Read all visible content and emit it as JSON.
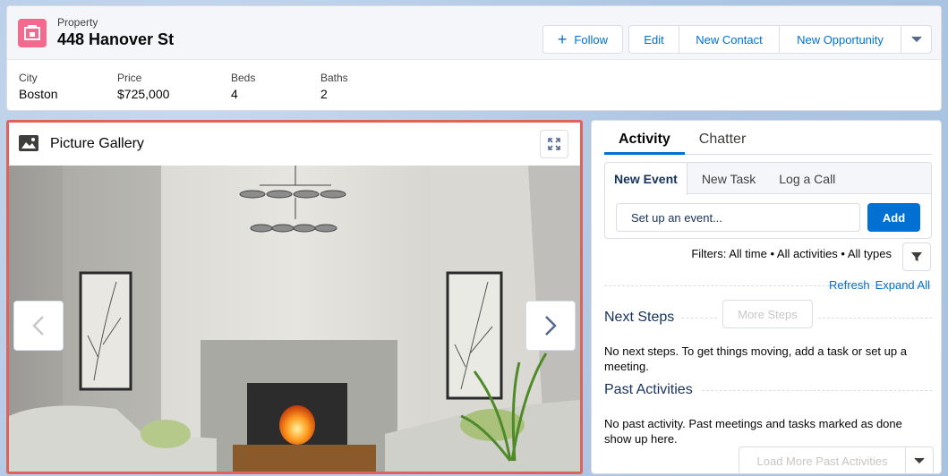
{
  "record": {
    "type_label": "Property",
    "name": "448 Hanover St"
  },
  "actions": {
    "follow_label": "Follow",
    "edit_label": "Edit",
    "new_contact_label": "New Contact",
    "new_opportunity_label": "New Opportunity"
  },
  "fields": [
    {
      "label": "City",
      "value": "Boston"
    },
    {
      "label": "Price",
      "value": "$725,000"
    },
    {
      "label": "Beds",
      "value": "4"
    },
    {
      "label": "Baths",
      "value": "2"
    }
  ],
  "gallery": {
    "title": "Picture Gallery"
  },
  "activity": {
    "tabs": [
      "Activity",
      "Chatter"
    ],
    "publisher_tabs": [
      "New Event",
      "New Task",
      "Log a Call"
    ],
    "event_placeholder": "Set up an event...",
    "add_label": "Add",
    "filters_text": "Filters: All time • All activities • All types",
    "refresh_label": "Refresh",
    "expand_all_label": "Expand All",
    "next_steps_title": "Next Steps",
    "more_steps_label": "More Steps",
    "next_steps_msg": "No next steps. To get things moving, add a task or set up a meeting.",
    "past_title": "Past Activities",
    "past_msg": "No past activity. Past meetings and tasks marked as done show up here.",
    "load_more_label": "Load More Past Activities"
  },
  "colors": {
    "brand": "#0070d2",
    "record_icon": "#f26a8d",
    "highlight_border": "#e0625b"
  }
}
